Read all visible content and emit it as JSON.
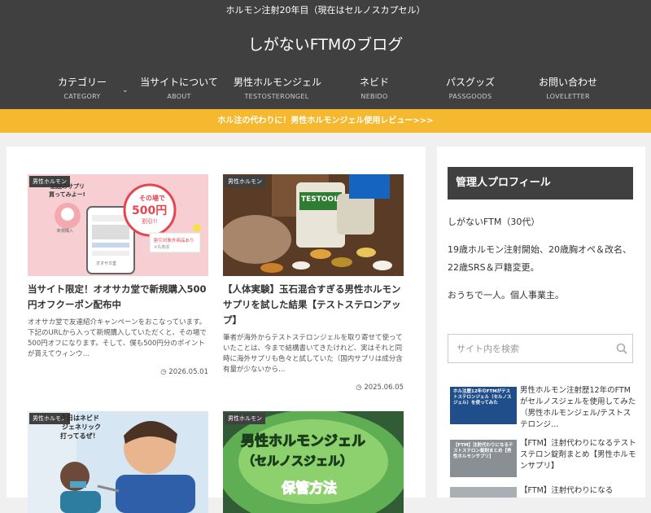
{
  "header": {
    "tagline": "ホルモン注射20年目（現在はセルノスカプセル）",
    "site_title": "しがないFTMのブログ",
    "nav": [
      {
        "label": "カテゴリー",
        "sub": "CATEGORY"
      },
      {
        "label": "当サイトについて",
        "sub": "ABOUT"
      },
      {
        "label": "男性ホルモンジェル",
        "sub": "TESTOSTERONGEL"
      },
      {
        "label": "ネビド",
        "sub": "NEBIDO"
      },
      {
        "label": "パスグッズ",
        "sub": "PASSGOODS"
      },
      {
        "label": "お問い合わせ",
        "sub": "LOVELETTER"
      }
    ]
  },
  "banner": {
    "text": "ホル注の代わりに！男性ホルモンジェル使用レビュー>>>"
  },
  "posts": [
    {
      "category": "男性ホルモン",
      "title": "当サイト限定！オオサカ堂で新規購入500円オフクーポン配布中",
      "excerpt": "オオサカ堂で友達紹介キャンペーンをおこなっています。下記のURLから入って新規購入していただくと、その場で500円オフになります。そして、僕も500円分のポイントが貰えてウィンウ…",
      "date": "2026.05.01",
      "thumb": {
        "bubble1": "話題のサプリ",
        "bubble2": "買ってみよー!",
        "circle1": "その場で",
        "circle2": "500円",
        "circle3": "割引!!",
        "sub1": "割引対象外商品あり",
        "sub2": "※先着順",
        "avatar": "新規購入",
        "small": "オオサカ堂"
      }
    },
    {
      "category": "男性ホルモン",
      "title": "【人体実験】玉石混合すぎる男性ホルモンサプリを試した結果【テストステロンアップ】",
      "excerpt": "筆者が海外からテストステロンジェルを取り寄せて使っていたことは、今まで結構書いてきたけれど、実はそれと同時に海外サプリも色々と試していた（国内サプリは成分含有量が少ないから…",
      "date": "2025.06.05",
      "thumb": {
        "jar_label": "TESTOOL"
      }
    },
    {
      "category": "男性ホルモン",
      "title": "",
      "excerpt": "",
      "date": "",
      "thumb": {
        "caption1": "今日はネビド",
        "caption2": "ジェネリック",
        "caption3": "打ってるぜ！"
      }
    },
    {
      "category": "男性ホルモン",
      "title": "",
      "excerpt": "",
      "date": "",
      "thumb": {
        "line1": "男性ホルモンジェル",
        "line2": "（セルノスジェル）",
        "line3": "保管方法"
      }
    }
  ],
  "sidebar": {
    "widget_title": "管理人プロフィール",
    "profile": [
      "しがないFTM（30代）",
      "19歳ホルモン注射開始、20歳胸オペ＆改名、22歳SRS＆戸籍変更。",
      "おうちで一人。個人事業主。"
    ],
    "search_placeholder": "サイト内を検索",
    "recent": [
      {
        "title": "男性ホルモン注射歴12年のFTMがセルノスジェルを使用してみた（男性ホルモンジェル/テストステロンジ…",
        "thumb": "ホル注歴12年のFTMがテストステロンジェル（セルノスジェル）を使ってみた"
      },
      {
        "title": "【FTM】注射代わりになるテストステロン錠剤まとめ【男性ホルモンサプリ】",
        "thumb": "【FTM】注射代わりになるテストステロン錠剤まとめ【男性ホルモンサプリ】"
      },
      {
        "title": "【FTM】注射代わりになる",
        "thumb": ""
      }
    ]
  },
  "colors": {
    "header_bg": "#404040",
    "banner_bg": "#f5b82e",
    "page_bg": "#f0f0f0"
  }
}
